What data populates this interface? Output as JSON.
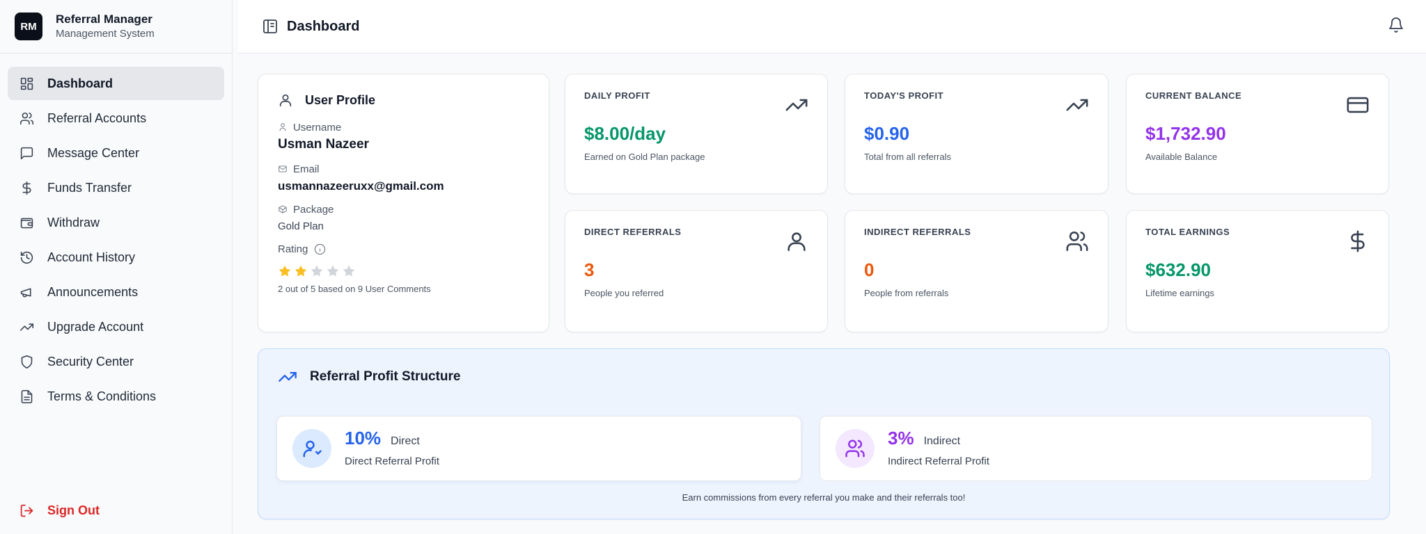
{
  "brand": {
    "logo": "RM",
    "title": "Referral Manager",
    "subtitle": "Management System"
  },
  "nav": {
    "items": [
      {
        "label": "Dashboard",
        "icon": "grid-icon",
        "active": true
      },
      {
        "label": "Referral Accounts",
        "icon": "users-icon"
      },
      {
        "label": "Message Center",
        "icon": "message-icon"
      },
      {
        "label": "Funds Transfer",
        "icon": "dollar-icon"
      },
      {
        "label": "Withdraw",
        "icon": "wallet-icon"
      },
      {
        "label": "Account History",
        "icon": "history-icon"
      },
      {
        "label": "Announcements",
        "icon": "megaphone-icon"
      },
      {
        "label": "Upgrade Account",
        "icon": "trending-up-icon"
      },
      {
        "label": "Security Center",
        "icon": "shield-icon"
      },
      {
        "label": "Terms & Conditions",
        "icon": "document-icon"
      }
    ],
    "signout": "Sign Out"
  },
  "header": {
    "title": "Dashboard"
  },
  "profile": {
    "title": "User Profile",
    "username_label": "Username",
    "username": "Usman Nazeer",
    "email_label": "Email",
    "email": "usmannazeeruxx@gmail.com",
    "package_label": "Package",
    "package": "Gold Plan",
    "rating_label": "Rating",
    "rating": 2,
    "rating_max": 5,
    "rating_note": "2 out of 5 based on 9 User Comments"
  },
  "stats": {
    "daily_profit": {
      "title": "Daily Profit",
      "value": "$8.00/day",
      "sub": "Earned on Gold Plan package",
      "color": "#059669"
    },
    "todays_profit": {
      "title": "Today's Profit",
      "value": "$0.90",
      "sub": "Total from all referrals",
      "color": "#2563eb"
    },
    "current_balance": {
      "title": "Current Balance",
      "value": "$1,732.90",
      "sub": "Available Balance",
      "color": "#9333ea"
    },
    "direct_referrals": {
      "title": "Direct Referrals",
      "value": "3",
      "sub": "People you referred",
      "color": "#ea580c"
    },
    "indirect_referrals": {
      "title": "Indirect Referrals",
      "value": "0",
      "sub": "People from referrals",
      "color": "#ea580c"
    },
    "total_earnings": {
      "title": "Total Earnings",
      "value": "$632.90",
      "sub": "Lifetime earnings",
      "color": "#059669"
    }
  },
  "structure": {
    "title": "Referral Profit Structure",
    "direct": {
      "pct": "10%",
      "label": "Direct",
      "desc": "Direct Referral Profit",
      "color": "#2563eb",
      "bg": "#dbeafe"
    },
    "indirect": {
      "pct": "3%",
      "label": "Indirect",
      "desc": "Indirect Referral Profit",
      "color": "#9333ea",
      "bg": "#f3e8ff"
    },
    "note": "Earn commissions from every referral you make and their referrals too!"
  },
  "colors": {
    "star_filled": "#fbbf24",
    "star_empty": "#d1d5db",
    "signout": "#dc2626"
  }
}
